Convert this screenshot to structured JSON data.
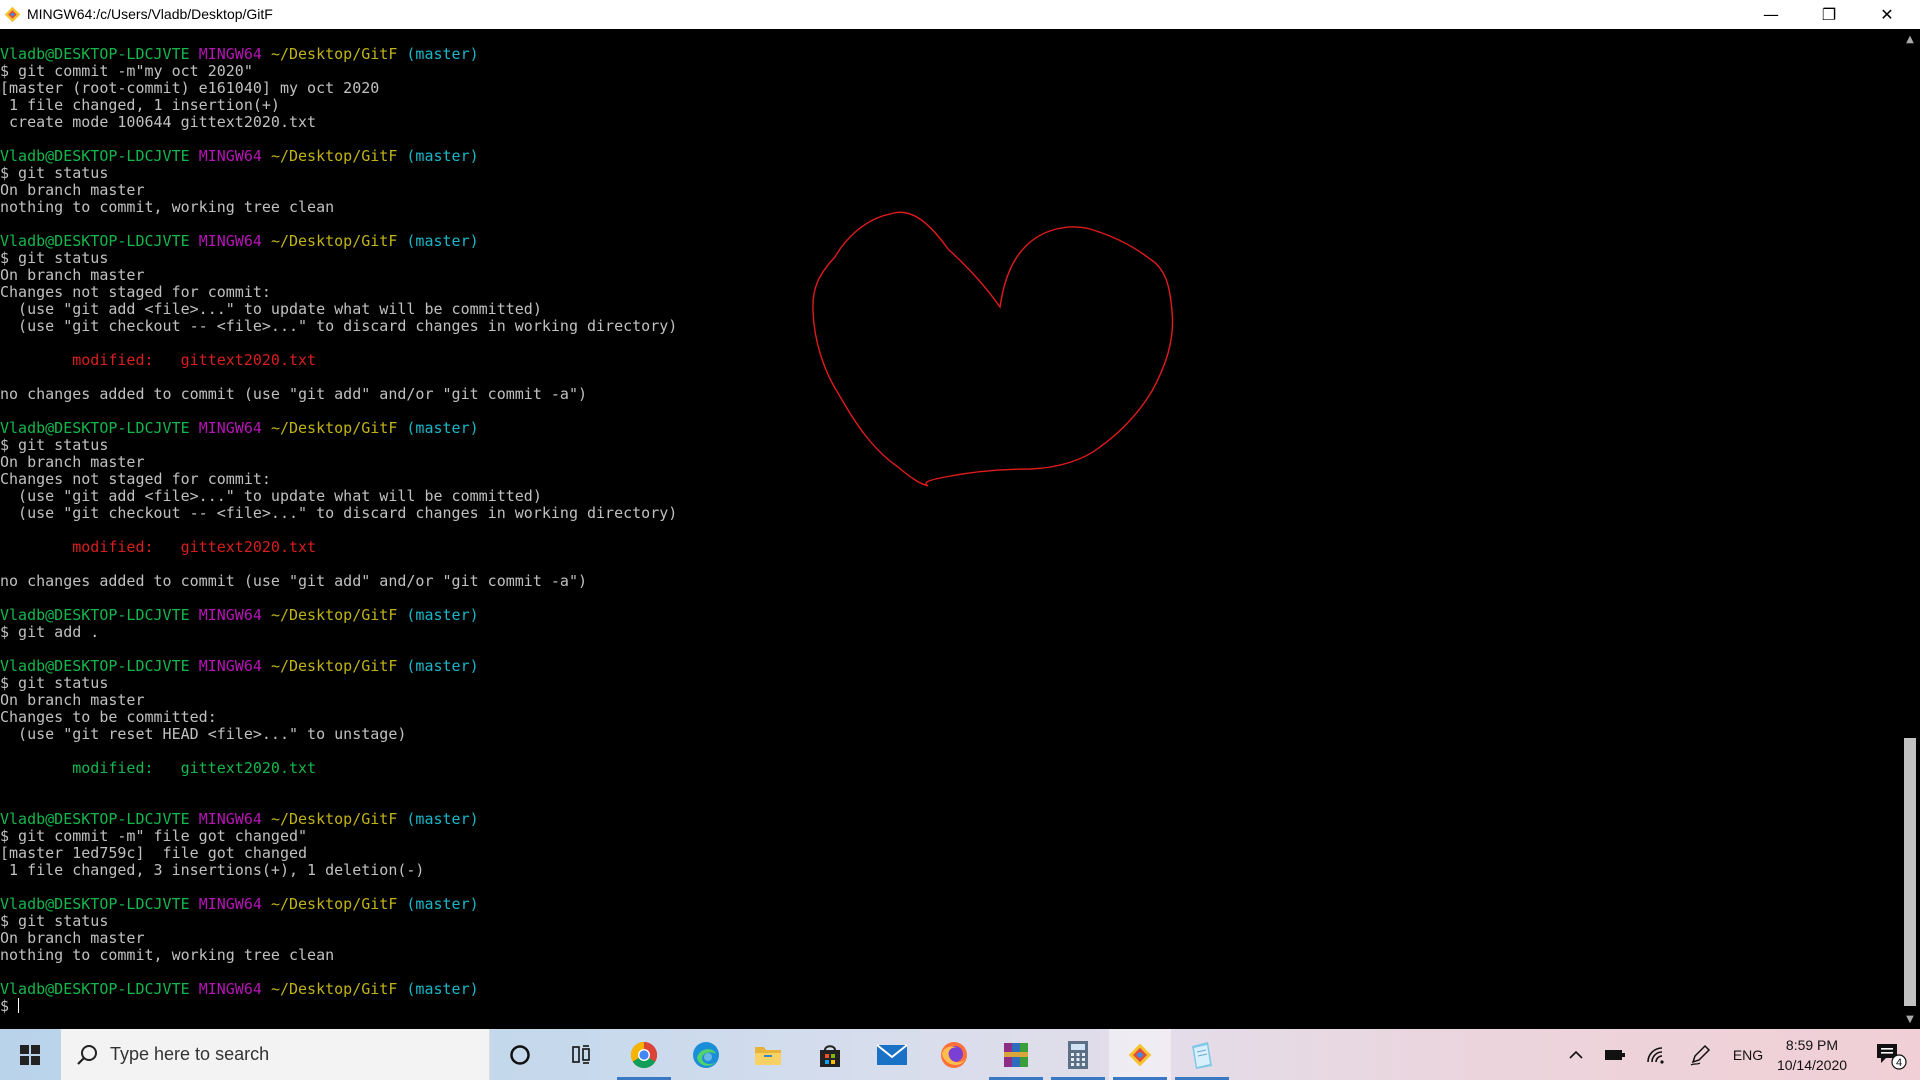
{
  "window": {
    "title": "MINGW64:/c/Users/Vladb/Desktop/GitF",
    "controls": {
      "minimize": "—",
      "maximize": "❐",
      "close": "✕"
    }
  },
  "prompt": {
    "user": "Vladb@DESKTOP-LDCJVTE",
    "host": "MINGW64",
    "path": "~/Desktop/GitF",
    "branch": "(master)"
  },
  "terminal": {
    "lines": [
      {
        "t": "prompt"
      },
      {
        "t": "out",
        "text": "$ git commit -m\"my oct 2020\""
      },
      {
        "t": "out",
        "text": "[master (root-commit) e161040] my oct 2020"
      },
      {
        "t": "out",
        "text": " 1 file changed, 1 insertion(+)"
      },
      {
        "t": "out",
        "text": " create mode 100644 gittext2020.txt"
      },
      {
        "t": "blank"
      },
      {
        "t": "prompt"
      },
      {
        "t": "out",
        "text": "$ git status"
      },
      {
        "t": "out",
        "text": "On branch master"
      },
      {
        "t": "out",
        "text": "nothing to commit, working tree clean"
      },
      {
        "t": "blank"
      },
      {
        "t": "prompt"
      },
      {
        "t": "out",
        "text": "$ git status"
      },
      {
        "t": "out",
        "text": "On branch master"
      },
      {
        "t": "out",
        "text": "Changes not staged for commit:"
      },
      {
        "t": "out",
        "text": "  (use \"git add <file>...\" to update what will be committed)"
      },
      {
        "t": "out",
        "text": "  (use \"git checkout -- <file>...\" to discard changes in working directory)"
      },
      {
        "t": "blank"
      },
      {
        "t": "red",
        "text": "        modified:   gittext2020.txt"
      },
      {
        "t": "blank"
      },
      {
        "t": "out",
        "text": "no changes added to commit (use \"git add\" and/or \"git commit -a\")"
      },
      {
        "t": "blank"
      },
      {
        "t": "prompt"
      },
      {
        "t": "out",
        "text": "$ git status"
      },
      {
        "t": "out",
        "text": "On branch master"
      },
      {
        "t": "out",
        "text": "Changes not staged for commit:"
      },
      {
        "t": "out",
        "text": "  (use \"git add <file>...\" to update what will be committed)"
      },
      {
        "t": "out",
        "text": "  (use \"git checkout -- <file>...\" to discard changes in working directory)"
      },
      {
        "t": "blank"
      },
      {
        "t": "red",
        "text": "        modified:   gittext2020.txt"
      },
      {
        "t": "blank"
      },
      {
        "t": "out",
        "text": "no changes added to commit (use \"git add\" and/or \"git commit -a\")"
      },
      {
        "t": "blank"
      },
      {
        "t": "prompt"
      },
      {
        "t": "out",
        "text": "$ git add ."
      },
      {
        "t": "blank"
      },
      {
        "t": "prompt"
      },
      {
        "t": "out",
        "text": "$ git status"
      },
      {
        "t": "out",
        "text": "On branch master"
      },
      {
        "t": "out",
        "text": "Changes to be committed:"
      },
      {
        "t": "out",
        "text": "  (use \"git reset HEAD <file>...\" to unstage)"
      },
      {
        "t": "blank"
      },
      {
        "t": "green",
        "text": "        modified:   gittext2020.txt"
      },
      {
        "t": "blank"
      },
      {
        "t": "blank"
      },
      {
        "t": "prompt"
      },
      {
        "t": "out",
        "text": "$ git commit -m\" file got changed\""
      },
      {
        "t": "out",
        "text": "[master 1ed759c]  file got changed"
      },
      {
        "t": "out",
        "text": " 1 file changed, 3 insertions(+), 1 deletion(-)"
      },
      {
        "t": "blank"
      },
      {
        "t": "prompt"
      },
      {
        "t": "out",
        "text": "$ git status"
      },
      {
        "t": "out",
        "text": "On branch master"
      },
      {
        "t": "out",
        "text": "nothing to commit, working tree clean"
      },
      {
        "t": "blank"
      },
      {
        "t": "prompt"
      },
      {
        "t": "input",
        "text": "$ "
      }
    ]
  },
  "drawing": {
    "shape": "heart-icon",
    "color": "#e01b1b"
  },
  "taskbar": {
    "search_placeholder": "Type here to search",
    "apps": [
      "cortana",
      "task-view",
      "chrome",
      "edge",
      "file-explorer",
      "store",
      "mail",
      "firefox",
      "winrar",
      "calculator",
      "git-bash",
      "notepad"
    ],
    "language": "ENG",
    "time": "8:59 PM",
    "date": "10/14/2020",
    "notification_count": "4"
  }
}
